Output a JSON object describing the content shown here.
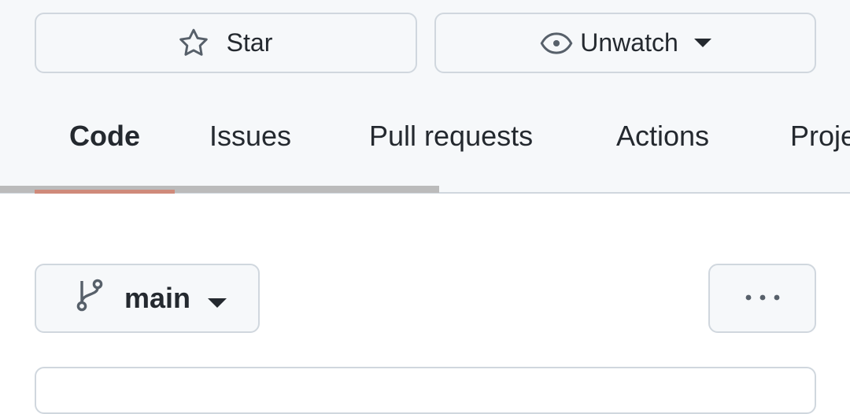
{
  "header": {
    "star_label": "Star",
    "watch_label": "Unwatch"
  },
  "tabs": [
    {
      "label": "Code",
      "active": true
    },
    {
      "label": "Issues",
      "active": false
    },
    {
      "label": "Pull requests",
      "active": false
    },
    {
      "label": "Actions",
      "active": false
    },
    {
      "label": "Projects",
      "active": false
    }
  ],
  "branch": {
    "name": "main"
  },
  "icons": {
    "star": "star-icon",
    "watch": "eye-icon",
    "branch": "git-branch-icon",
    "more": "kebab-horizontal-icon",
    "caret": "triangle-down-icon"
  },
  "colors": {
    "header_bg": "#f6f8fa",
    "border": "#d0d7de",
    "text": "#24292f",
    "active_tab_underline": "#cf8a7a"
  }
}
